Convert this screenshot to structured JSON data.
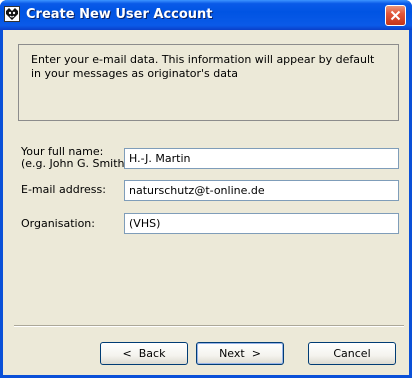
{
  "window": {
    "title": "Create New User Account",
    "app_icon": "app-icon",
    "close_icon": "close-icon",
    "accent_color": "#0054e3"
  },
  "info_text": "Enter your e-mail data. This information will appear by default in your messages as originator's data",
  "form": {
    "full_name": {
      "label": "Your full name:",
      "hint": "(e.g. John G. Smith)",
      "value": "H.-J. Martin"
    },
    "email": {
      "label": "E-mail address:",
      "value": "naturschutz@t-online.de"
    },
    "organisation": {
      "label": "Organisation:",
      "value": "(VHS)"
    }
  },
  "buttons": {
    "back": "<  Back",
    "next": "Next  >",
    "cancel": "Cancel"
  }
}
